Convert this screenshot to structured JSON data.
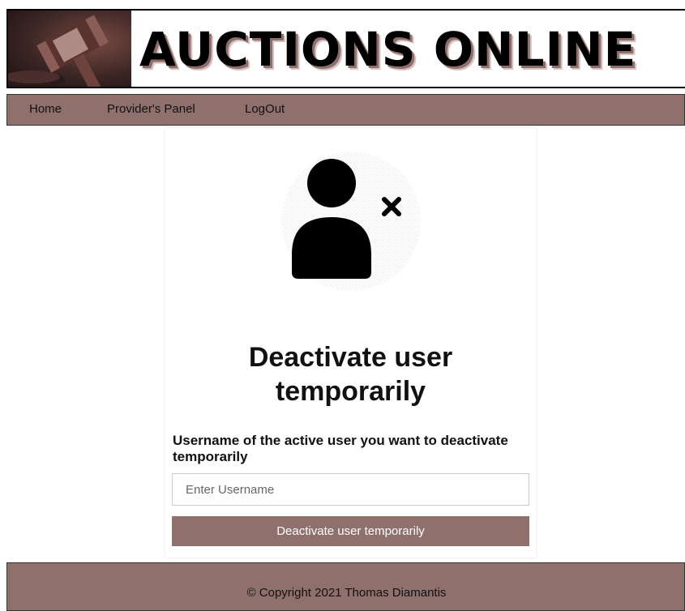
{
  "header": {
    "title": "AUCTIONS ONLINE",
    "logo_icon": "gavel-icon"
  },
  "nav": {
    "items": [
      {
        "label": "Home"
      },
      {
        "label": "Provider's Panel"
      },
      {
        "label": "LogOut"
      }
    ]
  },
  "form": {
    "icon": "user-remove-icon",
    "heading_line1": "Deactivate user",
    "heading_line2": "temporarily",
    "label": "Username of the active user you want to deactivate temporarily",
    "input_placeholder": "Enter Username",
    "input_value": "",
    "button_label": "Deactivate user temporarily"
  },
  "footer": {
    "copyright": "© Copyright 2021 Thomas Diamantis"
  },
  "colors": {
    "accent": "#8f706c",
    "text": "#111111"
  }
}
